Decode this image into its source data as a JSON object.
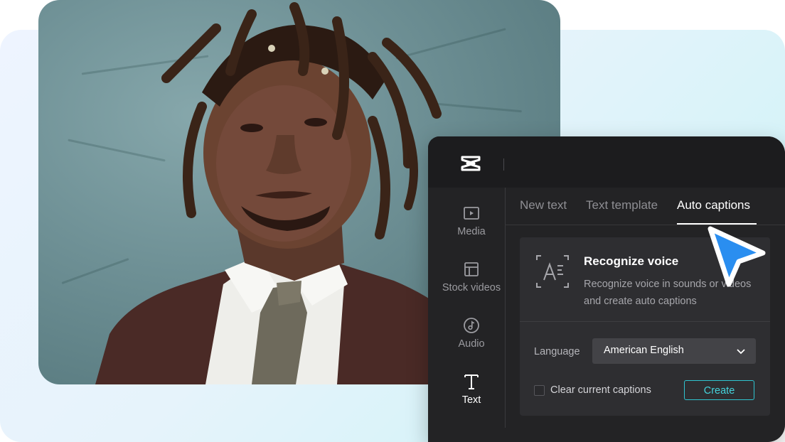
{
  "app": {
    "logo_icon": "capcut-logo-icon"
  },
  "sidebar": {
    "items": [
      {
        "label": "Media",
        "icon": "play-square-icon",
        "active": false
      },
      {
        "label": "Stock videos",
        "icon": "layout-icon",
        "active": false
      },
      {
        "label": "Audio",
        "icon": "music-note-icon",
        "active": false
      },
      {
        "label": "Text",
        "icon": "text-t-icon",
        "active": true
      }
    ]
  },
  "tabs": [
    {
      "label": "New text",
      "active": false
    },
    {
      "label": "Text template",
      "active": false
    },
    {
      "label": "Auto captions",
      "active": true
    }
  ],
  "recognize": {
    "title": "Recognize voice",
    "description": "Recognize voice in sounds or videos and create auto captions",
    "icon": "recognize-text-icon"
  },
  "language": {
    "label": "Language",
    "selected": "American English"
  },
  "clear_captions": {
    "label": "Clear current captions",
    "checked": false
  },
  "create_button": {
    "label": "Create"
  },
  "colors": {
    "panel_bg": "#232325",
    "accent": "#2fc4d0",
    "cursor": "#2a8ef0"
  }
}
